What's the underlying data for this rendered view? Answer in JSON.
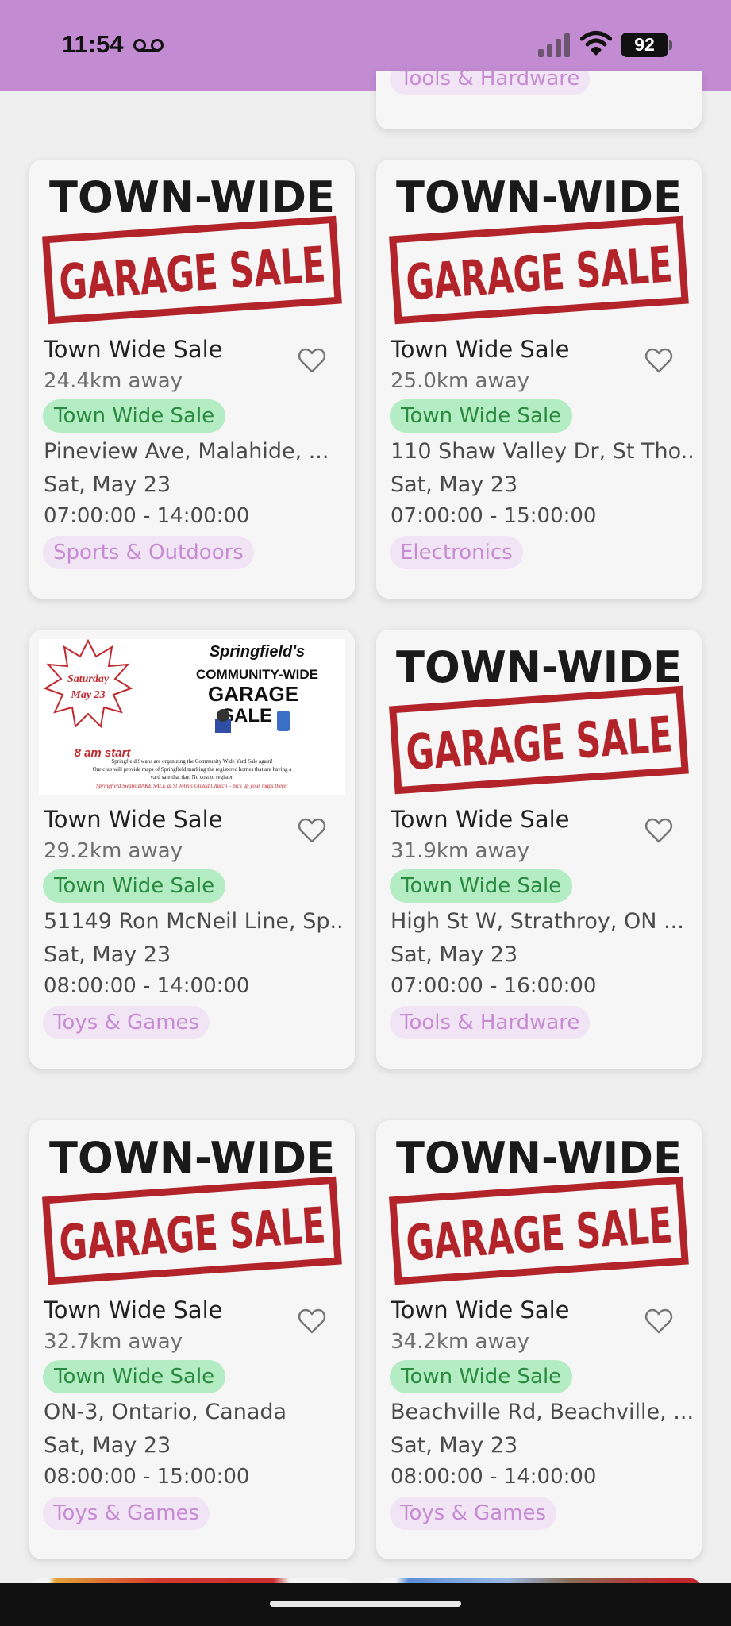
{
  "status_bar": {
    "time": "11:54",
    "battery": "92"
  },
  "partial_top": {
    "category": "Tools & Hardware"
  },
  "logo": {
    "line1": "TOWN-WIDE",
    "line2": "GARAGE SALE"
  },
  "flyer": {
    "star_line1": "Saturday",
    "star_line2": "May 23",
    "start": "8 am start",
    "heading1": "Springfield's",
    "heading2": "COMMUNITY-WIDE",
    "heading3": "GARAGE",
    "heading4": "SALE",
    "body1": "Springfield Swans are organizing the Community Wide Yard Sale again!",
    "body2": "Our club will provide maps of Springfield marking the registered homes that are having a",
    "body3": "yard sale that day.    No cost to register.",
    "body4": "Springfield Swans BAKE SALE at St John's United Church – pick up your maps there!"
  },
  "listings": [
    {
      "title": "Town Wide Sale",
      "distance": "24.4km away",
      "type": "Town Wide Sale",
      "address": "Pineview Ave, Malahide, ...",
      "date": "Sat, May 23",
      "hours": "07:00:00 - 14:00:00",
      "category": "Sports & Outdoors"
    },
    {
      "title": "Town Wide Sale",
      "distance": "25.0km away",
      "type": "Town Wide Sale",
      "address": "110 Shaw Valley Dr, St Tho...",
      "date": "Sat, May 23",
      "hours": "07:00:00 - 15:00:00",
      "category": "Electronics"
    },
    {
      "title": "Town Wide Sale",
      "distance": "29.2km away",
      "type": "Town Wide Sale",
      "address": "51149 Ron McNeil Line, Sp...",
      "date": "Sat, May 23",
      "hours": "08:00:00 - 14:00:00",
      "category": "Toys & Games"
    },
    {
      "title": "Town Wide Sale",
      "distance": "31.9km away",
      "type": "Town Wide Sale",
      "address": "High St W, Strathroy, ON ...",
      "date": "Sat, May 23",
      "hours": "07:00:00 - 16:00:00",
      "category": "Tools & Hardware"
    },
    {
      "title": "Town Wide Sale",
      "distance": "32.7km away",
      "type": "Town Wide Sale",
      "address": "ON-3, Ontario, Canada",
      "date": "Sat, May 23",
      "hours": "08:00:00 - 15:00:00",
      "category": "Toys & Games"
    },
    {
      "title": "Town Wide Sale",
      "distance": "34.2km away",
      "type": "Town Wide Sale",
      "address": "Beachville Rd, Beachville, ...",
      "date": "Sat, May 23",
      "hours": "08:00:00 - 14:00:00",
      "category": "Toys & Games"
    }
  ],
  "colors": {
    "status_bar": "#c38bd2",
    "type_badge_bg": "#b4ecc4",
    "type_badge_text": "#2a8b40",
    "category_bg": "#f1e4f4",
    "category_text": "#c68bd3",
    "logo_red": "#b3232a"
  }
}
